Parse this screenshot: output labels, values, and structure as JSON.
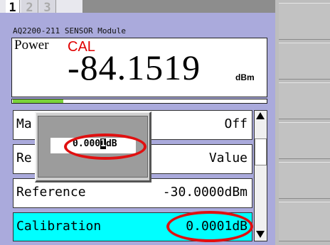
{
  "tabs": [
    {
      "label": "1",
      "active": true
    },
    {
      "label": "2",
      "active": false
    },
    {
      "label": "3",
      "active": false
    }
  ],
  "module_title": "AQ2200-211 SENSOR Module",
  "measurement": {
    "label": "Power",
    "status": "CAL",
    "value": "-84.1519",
    "unit": "dBm",
    "level_fraction": 0.2
  },
  "rows": [
    {
      "label": "Ma",
      "value": "Off"
    },
    {
      "label": "Re",
      "value": "Value"
    },
    {
      "label": "Reference",
      "value": "-30.0000dBm"
    },
    {
      "label": "Calibration",
      "value": "0.0001dB"
    }
  ],
  "popup": {
    "value_before": "0.000",
    "cursor_char": "1",
    "value_after": "dB"
  },
  "colors": {
    "panel": "#aaaadc",
    "selected_row": "#00ffff",
    "status_text": "#e00000",
    "level_bar": "#7ad23a",
    "highlight": "#e01010"
  }
}
